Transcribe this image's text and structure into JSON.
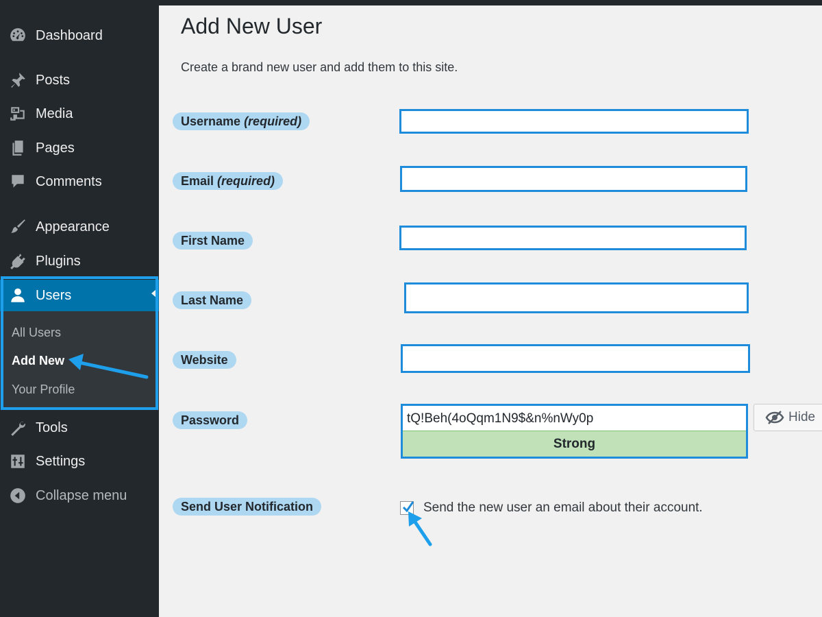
{
  "sidebar": {
    "items": [
      {
        "label": "Dashboard",
        "icon": "dashboard-icon"
      },
      {
        "label": "Posts",
        "icon": "pin-icon"
      },
      {
        "label": "Media",
        "icon": "media-icon"
      },
      {
        "label": "Pages",
        "icon": "pages-icon"
      },
      {
        "label": "Comments",
        "icon": "comment-icon"
      },
      {
        "label": "Appearance",
        "icon": "brush-icon"
      },
      {
        "label": "Plugins",
        "icon": "plugin-icon"
      },
      {
        "label": "Users",
        "icon": "user-icon"
      },
      {
        "label": "Tools",
        "icon": "wrench-icon"
      },
      {
        "label": "Settings",
        "icon": "settings-sliders-icon"
      },
      {
        "label": "Collapse menu",
        "icon": "collapse-icon"
      }
    ],
    "users_submenu": [
      "All Users",
      "Add New",
      "Your Profile"
    ]
  },
  "main": {
    "title": "Add New User",
    "description": "Create a brand new user and add them to this site.",
    "fields": {
      "username": {
        "label": "Username",
        "note": "(required)",
        "value": ""
      },
      "email": {
        "label": "Email",
        "note": "(required)",
        "value": ""
      },
      "first_name": {
        "label": "First Name",
        "value": ""
      },
      "last_name": {
        "label": "Last Name",
        "value": ""
      },
      "website": {
        "label": "Website",
        "value": ""
      },
      "password": {
        "label": "Password",
        "value": "tQ!Beh(4oQqm1N9$&n%nWy0p",
        "strength": "Strong",
        "hide_label": "Hide"
      },
      "notification": {
        "label": "Send User Notification",
        "checked": true,
        "text": "Send the new user an email about their account."
      }
    }
  },
  "colors": {
    "sidebar_bg": "#23282d",
    "active_menu": "#0073aa",
    "highlight_blue": "#1e9fec",
    "label_highlight": "#aed7f2",
    "strength_green": "#c1e1b9"
  }
}
